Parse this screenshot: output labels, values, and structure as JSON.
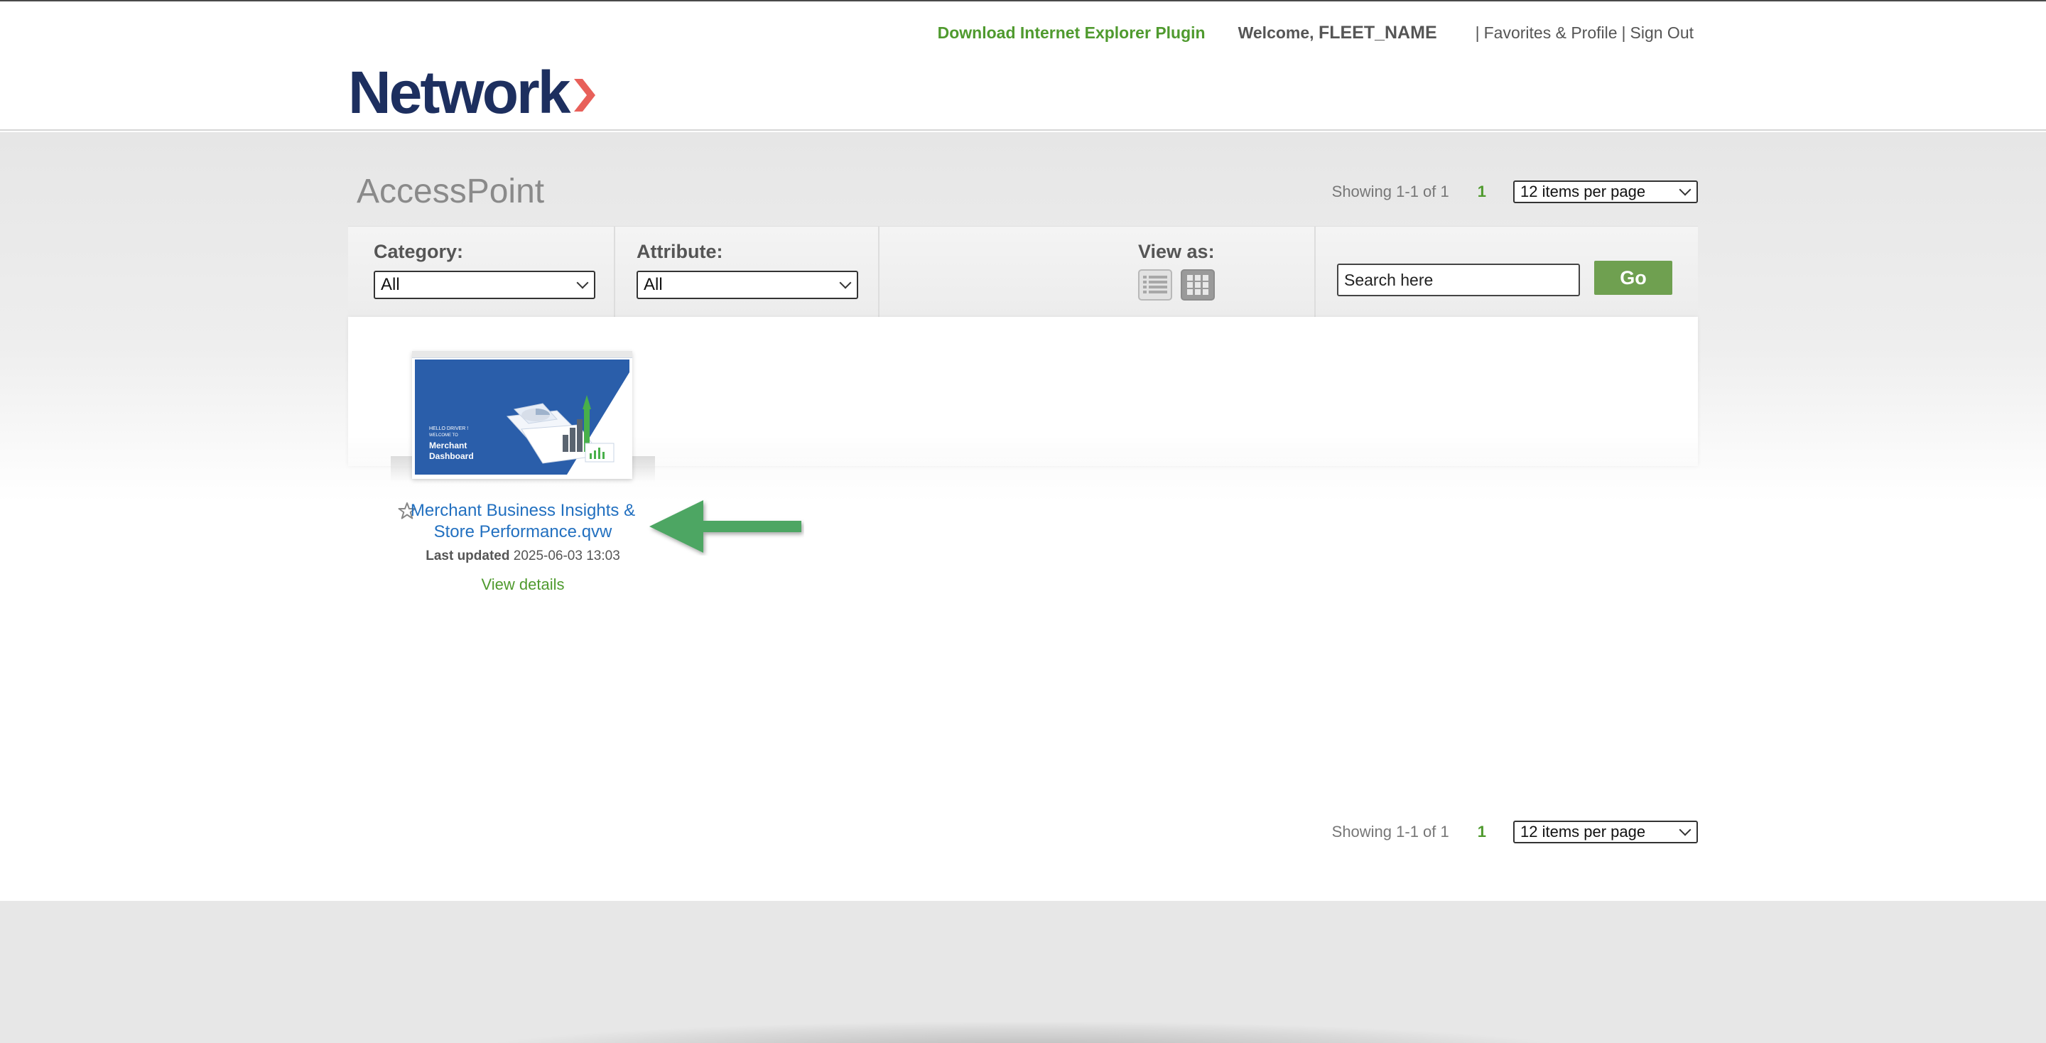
{
  "header": {
    "ie_plugin_link": "Download Internet Explorer Plugin",
    "welcome_prefix": "Welcome,",
    "username": "FLEET_NAME",
    "separator": "|",
    "favorites_link": "Favorites & Profile",
    "signout_link": "Sign Out",
    "logo_text": "Network",
    "logo_icon": "chevron-right-icon"
  },
  "page": {
    "title": "AccessPoint"
  },
  "pager_top": {
    "showing": "Showing 1-1 of 1",
    "page_number": "1",
    "per_page": "12 items per page"
  },
  "filters": {
    "category_label": "Category:",
    "category_value": "All",
    "attribute_label": "Attribute:",
    "attribute_value": "All",
    "view_as_label": "View as:",
    "view_icons": [
      "list-view-icon",
      "grid-view-icon"
    ],
    "search_placeholder": "Search here",
    "go_label": "Go"
  },
  "documents": [
    {
      "title": "Merchant Business Insights & Store Performance.qvw",
      "last_updated_label": "Last updated",
      "last_updated_value": "2025-06-03 13:03",
      "view_details": "View details",
      "thumbnail": {
        "greeting_line1": "HELLO DRIVER !",
        "greeting_line2": "WELCOME TO",
        "heading_line1": "Merchant",
        "heading_line2": "Dashboard"
      }
    }
  ],
  "pager_bottom": {
    "showing": "Showing 1-1 of 1",
    "page_number": "1",
    "per_page": "12 items per page"
  },
  "colors": {
    "brand_navy": "#1d2f5f",
    "brand_accent": "#e8605a",
    "green": "#4f9a2e",
    "go_button": "#6fa050",
    "link_blue": "#2270c0",
    "arrow_green": "#4da664"
  }
}
